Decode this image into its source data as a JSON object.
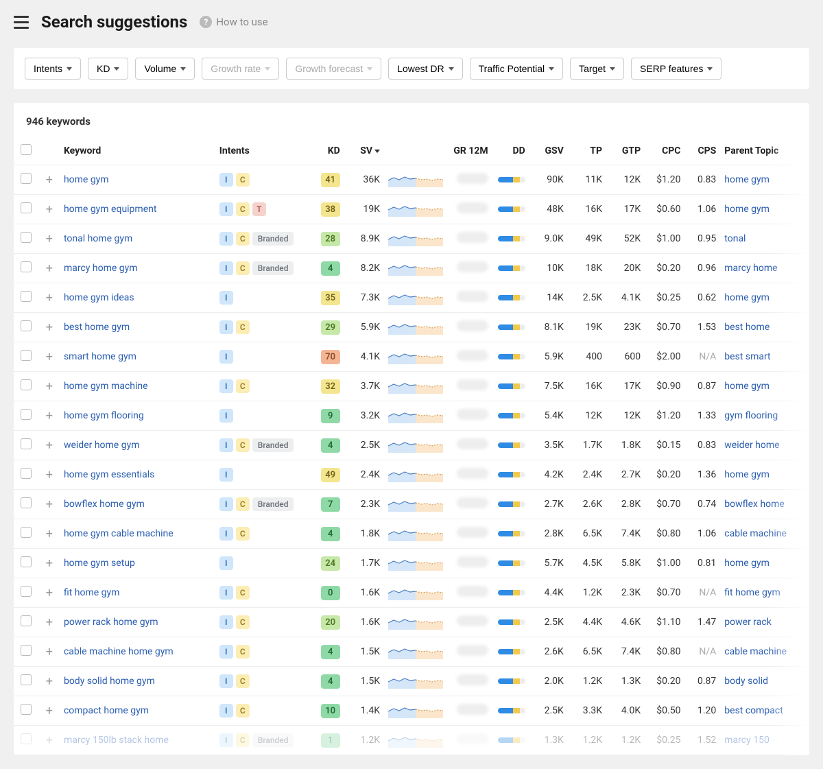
{
  "header": {
    "title": "Search suggestions",
    "help_label": "How to use"
  },
  "filters": [
    {
      "label": "Intents",
      "disabled": false
    },
    {
      "label": "KD",
      "disabled": false
    },
    {
      "label": "Volume",
      "disabled": false
    },
    {
      "label": "Growth rate",
      "disabled": true
    },
    {
      "label": "Growth forecast",
      "disabled": true
    },
    {
      "label": "Lowest DR",
      "disabled": false
    },
    {
      "label": "Traffic Potential",
      "disabled": false
    },
    {
      "label": "Target",
      "disabled": false
    },
    {
      "label": "SERP features",
      "disabled": false
    }
  ],
  "count_label": "946 keywords",
  "columns": {
    "keyword": "Keyword",
    "intents": "Intents",
    "kd": "KD",
    "sv": "SV",
    "gr12m": "GR 12M",
    "dd": "DD",
    "gsv": "GSV",
    "tp": "TP",
    "gtp": "GTP",
    "cpc": "CPC",
    "cps": "CPS",
    "parent": "Parent Topic"
  },
  "intent_labels": {
    "I": "I",
    "C": "C",
    "T": "T",
    "Branded": "Branded"
  },
  "rows": [
    {
      "keyword": "home gym",
      "intents": [
        "I",
        "C"
      ],
      "kd": 41,
      "kd_tone": "yellow",
      "sv": "36K",
      "gsv": "90K",
      "tp": "11K",
      "gtp": "12K",
      "cpc": "$1.20",
      "cps": "0.83",
      "parent": "home gym"
    },
    {
      "keyword": "home gym equipment",
      "intents": [
        "I",
        "C",
        "T"
      ],
      "kd": 38,
      "kd_tone": "yellow",
      "sv": "19K",
      "gsv": "48K",
      "tp": "16K",
      "gtp": "17K",
      "cpc": "$0.60",
      "cps": "1.06",
      "parent": "home gym"
    },
    {
      "keyword": "tonal home gym",
      "intents": [
        "I",
        "C",
        "Branded"
      ],
      "kd": 28,
      "kd_tone": "lightgreen",
      "sv": "8.9K",
      "gsv": "9.0K",
      "tp": "49K",
      "gtp": "52K",
      "cpc": "$1.00",
      "cps": "0.95",
      "parent": "tonal"
    },
    {
      "keyword": "marcy home gym",
      "intents": [
        "I",
        "C",
        "Branded"
      ],
      "kd": 4,
      "kd_tone": "green",
      "sv": "8.2K",
      "gsv": "10K",
      "tp": "18K",
      "gtp": "20K",
      "cpc": "$0.20",
      "cps": "0.96",
      "parent": "marcy home"
    },
    {
      "keyword": "home gym ideas",
      "intents": [
        "I"
      ],
      "kd": 35,
      "kd_tone": "yellow",
      "sv": "7.3K",
      "gsv": "14K",
      "tp": "2.5K",
      "gtp": "4.1K",
      "cpc": "$0.25",
      "cps": "0.62",
      "parent": "home gym"
    },
    {
      "keyword": "best home gym",
      "intents": [
        "I",
        "C"
      ],
      "kd": 29,
      "kd_tone": "lightgreen",
      "sv": "5.9K",
      "gsv": "8.1K",
      "tp": "19K",
      "gtp": "23K",
      "cpc": "$0.70",
      "cps": "1.53",
      "parent": "best home"
    },
    {
      "keyword": "smart home gym",
      "intents": [
        "I"
      ],
      "kd": 70,
      "kd_tone": "orange",
      "sv": "4.1K",
      "gsv": "5.9K",
      "tp": "400",
      "gtp": "600",
      "cpc": "$2.00",
      "cps": "N/A",
      "parent": "best smart"
    },
    {
      "keyword": "home gym machine",
      "intents": [
        "I",
        "C"
      ],
      "kd": 32,
      "kd_tone": "yellow",
      "sv": "3.7K",
      "gsv": "7.5K",
      "tp": "16K",
      "gtp": "17K",
      "cpc": "$0.90",
      "cps": "0.87",
      "parent": "home gym"
    },
    {
      "keyword": "home gym flooring",
      "intents": [
        "I"
      ],
      "kd": 9,
      "kd_tone": "green",
      "sv": "3.2K",
      "gsv": "5.4K",
      "tp": "12K",
      "gtp": "12K",
      "cpc": "$1.20",
      "cps": "1.33",
      "parent": "gym flooring"
    },
    {
      "keyword": "weider home gym",
      "intents": [
        "I",
        "C",
        "Branded"
      ],
      "kd": 4,
      "kd_tone": "green",
      "sv": "2.5K",
      "gsv": "3.5K",
      "tp": "1.7K",
      "gtp": "1.8K",
      "cpc": "$0.15",
      "cps": "0.83",
      "parent": "weider home"
    },
    {
      "keyword": "home gym essentials",
      "intents": [
        "I"
      ],
      "kd": 49,
      "kd_tone": "yellow",
      "sv": "2.4K",
      "gsv": "4.2K",
      "tp": "2.4K",
      "gtp": "2.7K",
      "cpc": "$0.20",
      "cps": "1.36",
      "parent": "home gym"
    },
    {
      "keyword": "bowflex home gym",
      "intents": [
        "I",
        "C",
        "Branded"
      ],
      "kd": 7,
      "kd_tone": "green",
      "sv": "2.3K",
      "gsv": "2.7K",
      "tp": "2.6K",
      "gtp": "2.8K",
      "cpc": "$0.70",
      "cps": "0.74",
      "parent": "bowflex home"
    },
    {
      "keyword": "home gym cable machine",
      "intents": [
        "I",
        "C"
      ],
      "kd": 4,
      "kd_tone": "green",
      "sv": "1.8K",
      "gsv": "2.8K",
      "tp": "6.5K",
      "gtp": "7.4K",
      "cpc": "$0.80",
      "cps": "1.06",
      "parent": "cable machine"
    },
    {
      "keyword": "home gym setup",
      "intents": [
        "I"
      ],
      "kd": 24,
      "kd_tone": "lightgreen",
      "sv": "1.7K",
      "gsv": "5.7K",
      "tp": "4.5K",
      "gtp": "5.8K",
      "cpc": "$1.00",
      "cps": "0.81",
      "parent": "home gym"
    },
    {
      "keyword": "fit home gym",
      "intents": [
        "I",
        "C"
      ],
      "kd": 0,
      "kd_tone": "green",
      "sv": "1.6K",
      "gsv": "4.4K",
      "tp": "1.2K",
      "gtp": "2.3K",
      "cpc": "$0.70",
      "cps": "N/A",
      "parent": "fit home gym"
    },
    {
      "keyword": "power rack home gym",
      "intents": [
        "I",
        "C"
      ],
      "kd": 20,
      "kd_tone": "lightgreen",
      "sv": "1.6K",
      "gsv": "2.5K",
      "tp": "4.4K",
      "gtp": "4.6K",
      "cpc": "$1.10",
      "cps": "1.47",
      "parent": "power rack"
    },
    {
      "keyword": "cable machine home gym",
      "intents": [
        "I",
        "C"
      ],
      "kd": 4,
      "kd_tone": "green",
      "sv": "1.5K",
      "gsv": "2.6K",
      "tp": "6.5K",
      "gtp": "7.4K",
      "cpc": "$0.80",
      "cps": "N/A",
      "parent": "cable machine"
    },
    {
      "keyword": "body solid home gym",
      "intents": [
        "I",
        "C"
      ],
      "kd": 4,
      "kd_tone": "green",
      "sv": "1.5K",
      "gsv": "2.0K",
      "tp": "1.2K",
      "gtp": "1.3K",
      "cpc": "$0.20",
      "cps": "0.87",
      "parent": "body solid"
    },
    {
      "keyword": "compact home gym",
      "intents": [
        "I",
        "C"
      ],
      "kd": 10,
      "kd_tone": "green",
      "sv": "1.4K",
      "gsv": "2.5K",
      "tp": "3.3K",
      "gtp": "4.0K",
      "cpc": "$0.50",
      "cps": "1.20",
      "parent": "best compact"
    },
    {
      "keyword": "marcy 150lb stack home",
      "intents": [
        "I",
        "C",
        "Branded"
      ],
      "kd": 1,
      "kd_tone": "green",
      "sv": "1.2K",
      "gsv": "1.3K",
      "tp": "1.2K",
      "gtp": "1.2K",
      "cpc": "$0.25",
      "cps": "1.52",
      "parent": "marcy 150",
      "faded": true
    }
  ]
}
